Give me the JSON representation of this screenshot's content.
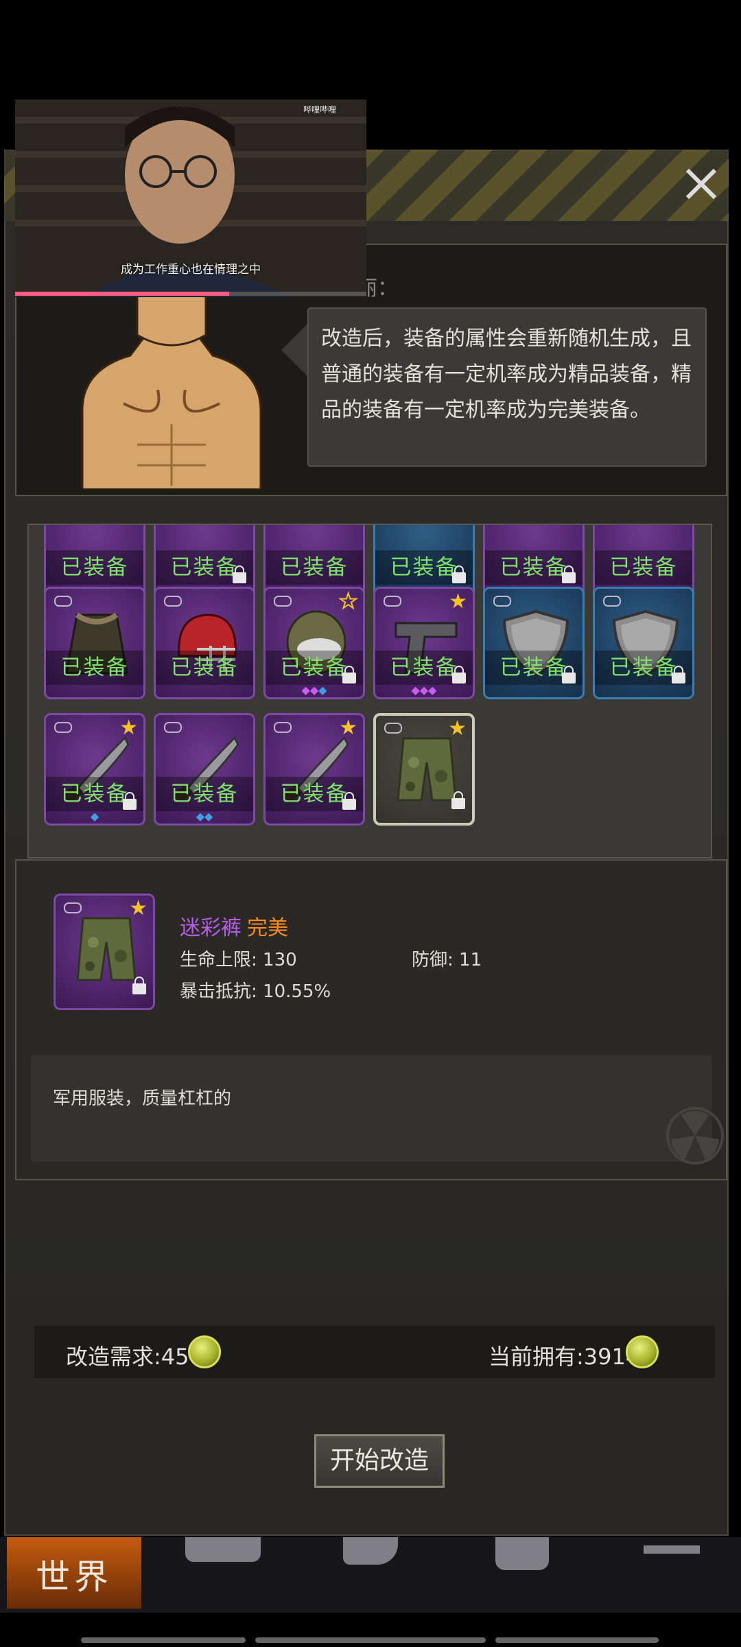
{
  "npc": {
    "name_partial": "丽：",
    "speech": "改造后，装备的属性会重新随机生成，且普通的装备有一定机率成为精品装备，精品的装备有一定机率成为完美装备。"
  },
  "video": {
    "caption": "成为工作重心也在情理之中",
    "logo": "哔哩哔哩",
    "progress": 0.61
  },
  "equipped_label": "已装备",
  "grid": {
    "rows": [
      [
        {
          "rarity": "purple",
          "equipped": true,
          "lock": false
        },
        {
          "rarity": "purple",
          "equipped": true,
          "lock": true
        },
        {
          "rarity": "purple",
          "equipped": true,
          "lock": false
        },
        {
          "rarity": "blue",
          "equipped": true,
          "lock": true
        },
        {
          "rarity": "purple",
          "equipped": true,
          "lock": true,
          "gems": [
            "p",
            "p",
            "w"
          ]
        },
        {
          "rarity": "purple",
          "equipped": true,
          "lock": false
        }
      ],
      [
        {
          "rarity": "purple",
          "equipped": true,
          "item": "jacket-icon"
        },
        {
          "rarity": "purple",
          "equipped": true,
          "item": "helmet-icon"
        },
        {
          "rarity": "purple",
          "equipped": true,
          "lock": true,
          "star": "hollow",
          "item": "gas-mask-icon",
          "gems": [
            "p",
            "p",
            "b"
          ]
        },
        {
          "rarity": "purple",
          "equipped": true,
          "lock": true,
          "star": "full",
          "item": "pistol-icon",
          "gems": [
            "p",
            "p",
            "p"
          ]
        },
        {
          "rarity": "blue",
          "equipped": true,
          "lock": true,
          "item": "shield-icon"
        },
        {
          "rarity": "blue",
          "equipped": true,
          "lock": true,
          "item": "shield-icon"
        }
      ],
      [
        {
          "rarity": "purple",
          "equipped": true,
          "lock": true,
          "star": "full",
          "item": "machete-icon",
          "gems": [
            "b"
          ]
        },
        {
          "rarity": "purple",
          "equipped": true,
          "item": "machete-icon",
          "gems": [
            "b",
            "b"
          ]
        },
        {
          "rarity": "purple",
          "equipped": true,
          "lock": true,
          "star": "full",
          "item": "machete-icon"
        },
        {
          "rarity": "selected",
          "equipped": false,
          "lock": true,
          "star": "full",
          "item": "camo-pants-icon"
        }
      ]
    ]
  },
  "detail": {
    "name": "迷彩裤",
    "quality": "完美",
    "stats": {
      "hp": "生命上限: 130",
      "defense": "防御: 11",
      "crit_resist": "暴击抵抗: 10.55%"
    },
    "description": "军用服装，质量杠杠的"
  },
  "cost": {
    "required": "改造需求:45",
    "owned": "当前拥有:3914"
  },
  "start_button": "开始改造",
  "nav": {
    "world": "世界"
  },
  "colors": {
    "equipped_text": "#7fe36a",
    "purple_item": "#b75ce6",
    "perfect_quality": "#ff8a1e",
    "star": "#f3c12a"
  }
}
